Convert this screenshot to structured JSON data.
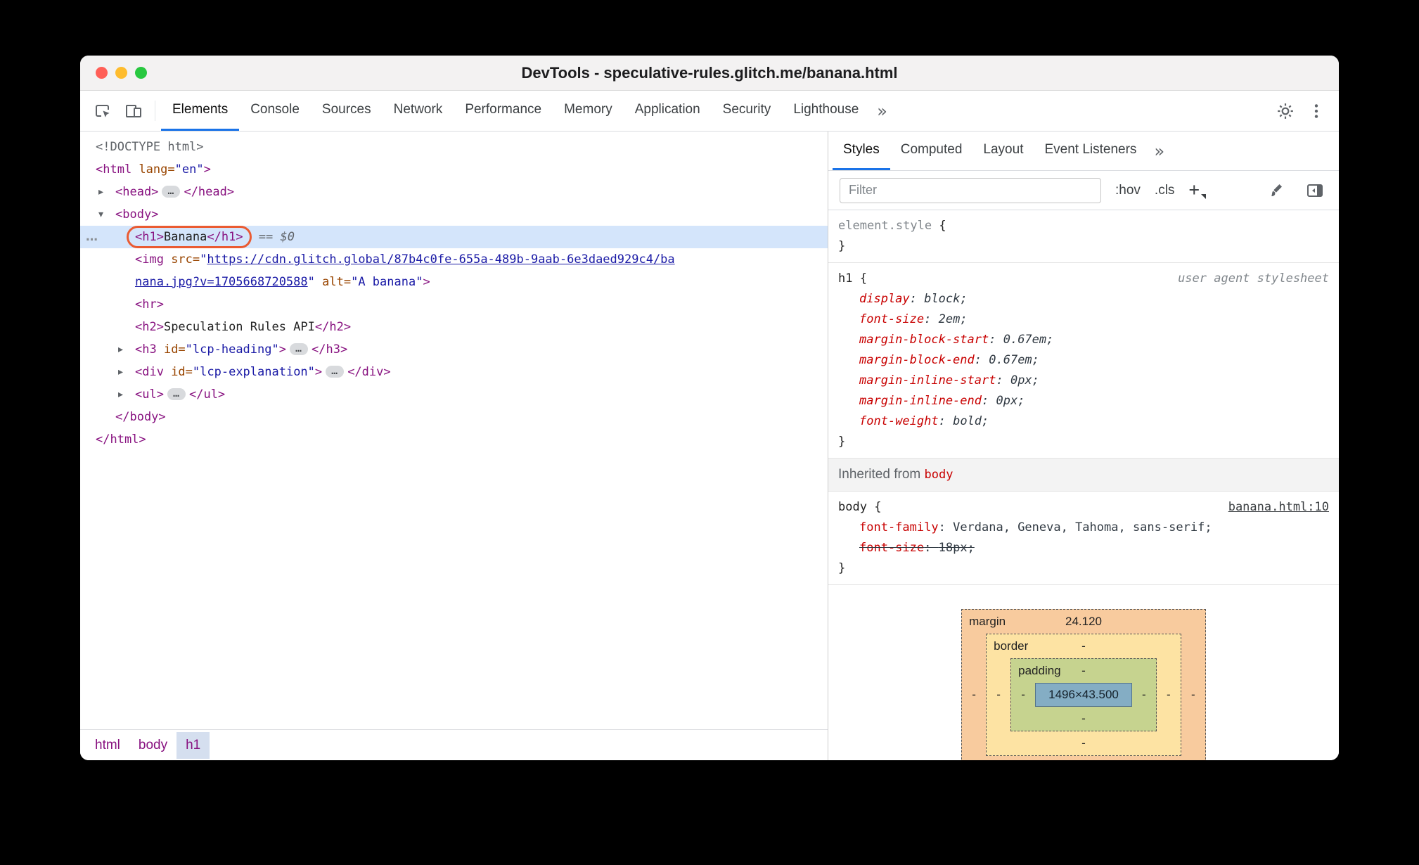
{
  "window": {
    "title": "DevTools - speculative-rules.glitch.me/banana.html"
  },
  "main_tabs": {
    "items": [
      {
        "label": "Elements",
        "active": true
      },
      {
        "label": "Console"
      },
      {
        "label": "Sources"
      },
      {
        "label": "Network"
      },
      {
        "label": "Performance"
      },
      {
        "label": "Memory"
      },
      {
        "label": "Application"
      },
      {
        "label": "Security"
      },
      {
        "label": "Lighthouse"
      }
    ],
    "overflow": "»"
  },
  "dom_tree": {
    "gutter_icon": "…",
    "lines": [
      {
        "ind": 0,
        "seg": [
          {
            "c": "d",
            "t": "<!DOCTYPE html>"
          }
        ]
      },
      {
        "ind": 0,
        "seg": [
          {
            "c": "t",
            "t": "<html"
          },
          {
            "c": "a",
            "t": " lang="
          },
          {
            "c": "v",
            "t": "\"en\""
          },
          {
            "c": "t",
            "t": ">"
          }
        ]
      },
      {
        "ind": 1,
        "arrow": "collapsed",
        "seg": [
          {
            "c": "t",
            "t": "<head>"
          },
          {
            "c": "p",
            "t": "…"
          },
          {
            "c": "t",
            "t": "</head>"
          }
        ]
      },
      {
        "ind": 1,
        "arrow": "expanded",
        "seg": [
          {
            "c": "t",
            "t": "<body>"
          }
        ]
      },
      {
        "ind": 2,
        "sel": true,
        "gutter": true,
        "seg": [
          {
            "c": "t",
            "t": "<h1>",
            "hl": true
          },
          {
            "c": "x",
            "t": "Banana",
            "hl": true
          },
          {
            "c": "t",
            "t": "</h1>",
            "hl": true
          },
          {
            "c": "m",
            "t": " == $0"
          }
        ]
      },
      {
        "ind": 2,
        "seg": [
          {
            "c": "t",
            "t": "<img"
          },
          {
            "c": "a",
            "t": " src="
          },
          {
            "c": "v",
            "t": "\""
          },
          {
            "c": "l",
            "t": "https://cdn.glitch.global/87b4c0fe-655a-489b-9aab-6e3daed929c4/ba"
          }
        ]
      },
      {
        "ind": 2,
        "seg": [
          {
            "c": "l",
            "t": "nana.jpg?v=1705668720588"
          },
          {
            "c": "v",
            "t": "\""
          },
          {
            "c": "a",
            "t": " alt="
          },
          {
            "c": "v",
            "t": "\"A banana\""
          },
          {
            "c": "t",
            "t": ">"
          }
        ]
      },
      {
        "ind": 2,
        "seg": [
          {
            "c": "t",
            "t": "<hr>"
          }
        ]
      },
      {
        "ind": 2,
        "seg": [
          {
            "c": "t",
            "t": "<h2>"
          },
          {
            "c": "x",
            "t": "Speculation Rules API"
          },
          {
            "c": "t",
            "t": "</h2>"
          }
        ]
      },
      {
        "ind": 2,
        "arrow": "collapsed",
        "seg": [
          {
            "c": "t",
            "t": "<h3"
          },
          {
            "c": "a",
            "t": " id="
          },
          {
            "c": "v",
            "t": "\"lcp-heading\""
          },
          {
            "c": "t",
            "t": ">"
          },
          {
            "c": "p",
            "t": "…"
          },
          {
            "c": "t",
            "t": "</h3>"
          }
        ]
      },
      {
        "ind": 2,
        "arrow": "collapsed",
        "seg": [
          {
            "c": "t",
            "t": "<div"
          },
          {
            "c": "a",
            "t": " id="
          },
          {
            "c": "v",
            "t": "\"lcp-explanation\""
          },
          {
            "c": "t",
            "t": ">"
          },
          {
            "c": "p",
            "t": "…"
          },
          {
            "c": "t",
            "t": "</div>"
          }
        ]
      },
      {
        "ind": 2,
        "arrow": "collapsed",
        "seg": [
          {
            "c": "t",
            "t": "<ul>"
          },
          {
            "c": "p",
            "t": "…"
          },
          {
            "c": "t",
            "t": "</ul>"
          }
        ]
      },
      {
        "ind": 1,
        "seg": [
          {
            "c": "t",
            "t": "</body>"
          }
        ]
      },
      {
        "ind": 0,
        "seg": [
          {
            "c": "t",
            "t": "</html>"
          }
        ]
      }
    ],
    "breadcrumbs": [
      {
        "label": "html"
      },
      {
        "label": "body"
      },
      {
        "label": "h1",
        "selected": true
      }
    ]
  },
  "styles_panel": {
    "tabs": [
      {
        "label": "Styles",
        "active": true
      },
      {
        "label": "Computed"
      },
      {
        "label": "Layout"
      },
      {
        "label": "Event Listeners"
      }
    ],
    "overflow": "»",
    "filter_placeholder": "Filter",
    "hov_label": ":hov",
    "cls_label": ".cls",
    "plus_label": "+",
    "punct": {
      "open": "{",
      "close": "}",
      "colon": ": ",
      "semi": ";"
    },
    "element_style": {
      "selector": "element.style"
    },
    "rules": [
      {
        "selector": "h1",
        "origin": "user agent stylesheet",
        "props": [
          {
            "name": "display",
            "value": "block"
          },
          {
            "name": "font-size",
            "value": "2em"
          },
          {
            "name": "margin-block-start",
            "value": "0.67em"
          },
          {
            "name": "margin-block-end",
            "value": "0.67em"
          },
          {
            "name": "margin-inline-start",
            "value": "0px"
          },
          {
            "name": "margin-inline-end",
            "value": "0px"
          },
          {
            "name": "font-weight",
            "value": "bold"
          }
        ]
      }
    ],
    "inherited_header": {
      "prefix": "Inherited from ",
      "node": "body"
    },
    "body_rule": {
      "selector": "body",
      "origin": "banana.html:10",
      "props": [
        {
          "name": "font-family",
          "value": "Verdana, Geneva, Tahoma, sans-serif"
        },
        {
          "name": "font-size",
          "value": "18px",
          "struck": true
        }
      ]
    },
    "box_model": {
      "margin_label": "margin",
      "margin_top": "24.120",
      "border_label": "border",
      "border_top": "-",
      "padding_label": "padding",
      "padding_top": "-",
      "content": "1496×43.500",
      "padding_bottom": "-",
      "border_bottom": "-",
      "side_dash": "-"
    }
  }
}
